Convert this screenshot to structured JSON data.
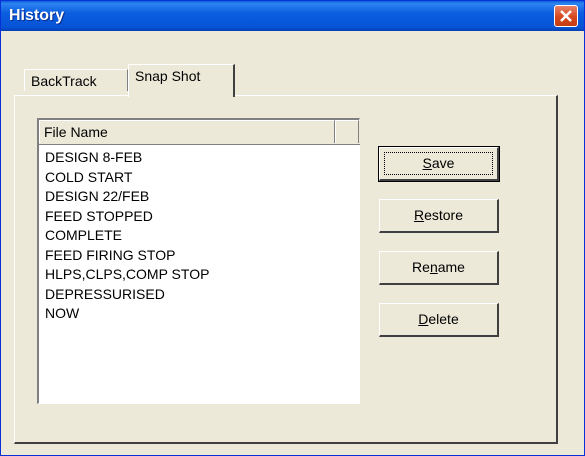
{
  "window": {
    "title": "History"
  },
  "tabs": [
    {
      "label": "BackTrack",
      "active": false
    },
    {
      "label": "Snap Shot",
      "active": true
    }
  ],
  "list": {
    "column_header": "File Name",
    "items": [
      "DESIGN 8-FEB",
      "COLD START",
      "DESIGN 22/FEB",
      "FEED STOPPED",
      "COMPLETE",
      "FEED FIRING STOP",
      "HLPS,CLPS,COMP STOP",
      "DEPRESSURISED",
      "NOW"
    ]
  },
  "buttons": {
    "save": {
      "accel": "S",
      "rest": "ave"
    },
    "restore": {
      "accel": "R",
      "rest": "estore"
    },
    "rename": {
      "pre": "Re",
      "accel": "n",
      "rest": "ame"
    },
    "delete": {
      "accel": "D",
      "rest": "elete"
    }
  },
  "colors": {
    "titlebar": "#0653d6",
    "close_button": "#d8481e",
    "face": "#ece9d8"
  },
  "icons": {
    "close": "close-icon"
  }
}
